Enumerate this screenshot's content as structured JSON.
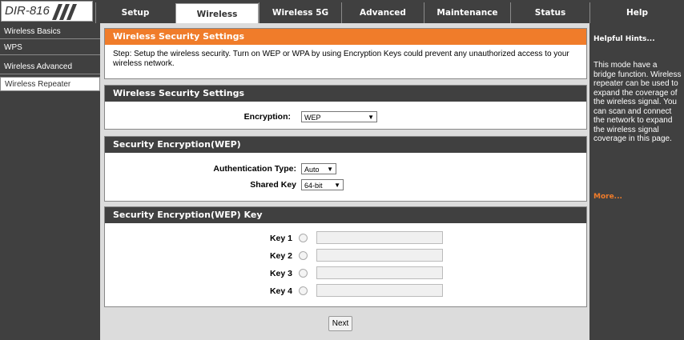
{
  "logo": {
    "brand": "DIR-816"
  },
  "nav": {
    "tabs": [
      {
        "label": "Setup"
      },
      {
        "label": "Wireless"
      },
      {
        "label": "Wireless 5G"
      },
      {
        "label": "Advanced"
      },
      {
        "label": "Maintenance"
      },
      {
        "label": "Status"
      },
      {
        "label": "Help"
      }
    ],
    "active": "Wireless"
  },
  "sidebar": {
    "items": [
      {
        "label": "Wireless Basics"
      },
      {
        "label": "WPS"
      },
      {
        "label": "Wireless Advanced"
      },
      {
        "label": "Wireless Repeater"
      }
    ],
    "active": "Wireless Repeater"
  },
  "intro": {
    "title": "Wireless Security Settings",
    "text": "Step: Setup the wireless security. Turn on WEP or WPA by using Encryption Keys could prevent any unauthorized access to your wireless network."
  },
  "security": {
    "title": "Wireless Security Settings",
    "encryption_label": "Encryption:",
    "encryption_value": "WEP"
  },
  "wep": {
    "title": "Security Encryption(WEP)",
    "auth_label": "Authentication Type:",
    "auth_value": "Auto",
    "shared_label": "Shared Key",
    "shared_value": "64-bit"
  },
  "wepkey": {
    "title": "Security Encryption(WEP) Key",
    "keys": [
      {
        "label": "Key 1",
        "value": ""
      },
      {
        "label": "Key 2",
        "value": ""
      },
      {
        "label": "Key 3",
        "value": ""
      },
      {
        "label": "Key 4",
        "value": ""
      }
    ]
  },
  "actions": {
    "next_label": "Next"
  },
  "hints": {
    "title": "Helpful Hints...",
    "text": "This mode have a bridge function. Wireless repeater can be used to expand the coverage of the wireless signal. You can scan and connect the network to expand the wireless signal coverage in this page.",
    "more": "More..."
  }
}
